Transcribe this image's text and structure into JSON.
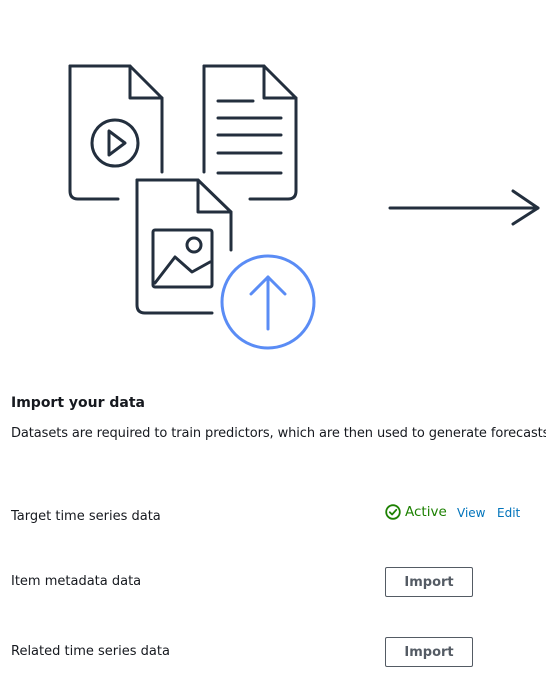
{
  "illustration": {
    "icons": [
      "video-file-icon",
      "text-document-icon",
      "image-file-icon",
      "upload-circle-icon",
      "arrow-right-icon"
    ],
    "colors": {
      "outline": "#232f3e",
      "accent": "#5a8cf5"
    }
  },
  "section": {
    "title": "Import your data",
    "description": "Datasets are required to train predictors, which are then used to generate forecasts."
  },
  "datasets": [
    {
      "label": "Target time series data",
      "status": "Active",
      "status_icon": "check-circle-icon",
      "status_color": "#1d8102",
      "view_label": "View",
      "edit_label": "Edit"
    },
    {
      "label": "Item metadata data",
      "import_label": "Import"
    },
    {
      "label": "Related time series data",
      "import_label": "Import"
    }
  ],
  "colors": {
    "link": "#0073bb",
    "button_border": "#545b64"
  }
}
